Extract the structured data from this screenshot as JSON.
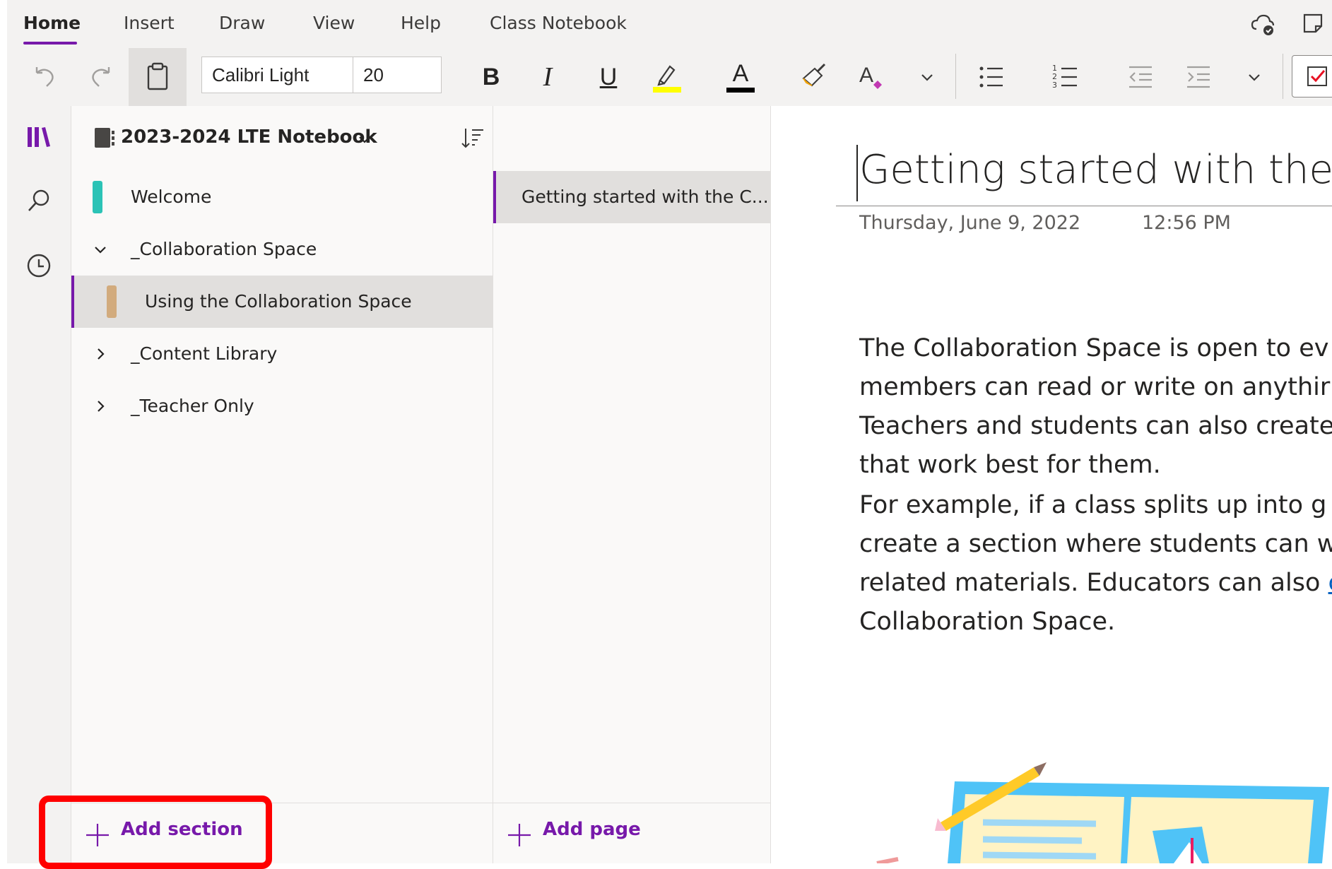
{
  "ribbon": {
    "tabs": [
      "Home",
      "Insert",
      "Draw",
      "View",
      "Help",
      "Class Notebook"
    ],
    "active_tab": "Home"
  },
  "toolbar": {
    "font_name": "Calibri Light",
    "font_size": "20",
    "bold_label": "B",
    "italic_label": "I",
    "underline_label": "U",
    "font_color_label": "A",
    "highlight_color": "#ffff00",
    "font_color": "#000000"
  },
  "notebook": {
    "title": "2023-2024 LTE Notebook"
  },
  "sections": {
    "items": [
      {
        "label": "Welcome",
        "color": "#2bc3b6"
      },
      {
        "label": "_Collaboration Space",
        "expanded": true
      },
      {
        "label": "Using the Collaboration Space",
        "color": "#d2ab7d",
        "selected": true
      },
      {
        "label": "_Content Library",
        "expanded": false
      },
      {
        "label": "_Teacher Only",
        "expanded": false
      }
    ],
    "add_label": "Add section"
  },
  "pages": {
    "items": [
      {
        "label": "Getting started with the C...",
        "selected": true
      }
    ],
    "add_label": "Add page"
  },
  "page": {
    "title": "Getting started with the",
    "date": "Thursday, June 9, 2022",
    "time": "12:56 PM",
    "paragraph1": [
      "The Collaboration Space is open to ev",
      "members can read or write on anythir",
      "Teachers and students can also create",
      "that work best for them."
    ],
    "paragraph2": [
      "For example, if a class splits up into g",
      "create a section where students can w",
      "related materials. Educators can also ",
      "Collaboration Space."
    ],
    "paragraph2_link_fragment": "c"
  },
  "colors": {
    "accent": "#7719aa",
    "highlight_box": "#ff0000"
  }
}
